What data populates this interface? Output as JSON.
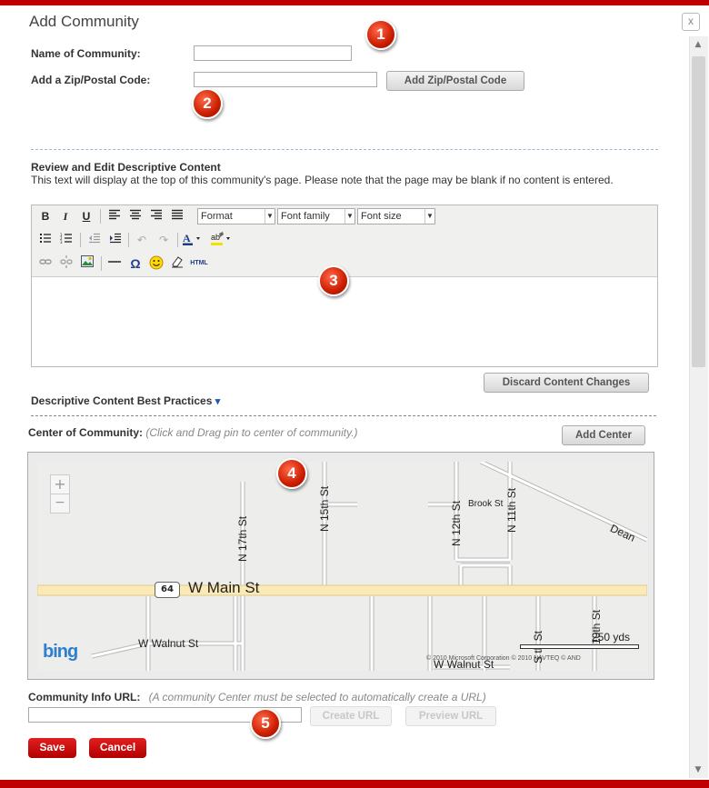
{
  "dialog": {
    "title": "Add Community",
    "close_glyph": "x"
  },
  "form": {
    "name_label": "Name of Community:",
    "name_value": "",
    "zip_label": "Add a Zip/Postal Code:",
    "zip_value": "",
    "add_zip_button": "Add Zip/Postal Code"
  },
  "content": {
    "heading": "Review and Edit Descriptive Content",
    "description": "This text will display at the top of this community's page. Please note that the page may be blank if no content is entered.",
    "editor": {
      "format_select": "Format",
      "font_family_select": "Font family",
      "font_size_select": "Font size",
      "bold": "B",
      "italic": "I",
      "underline": "U",
      "special_char": "Ω",
      "html_button": "HTML",
      "body_text": ""
    },
    "discard_button": "Discard Content Changes",
    "best_practices_link": "Descriptive Content Best Practices",
    "best_practices_arrow": "▾"
  },
  "center": {
    "label": "Center of Community:",
    "hint": "(Click and Drag pin to center of community.)",
    "add_center_button": "Add Center"
  },
  "map": {
    "zoom_in": "+",
    "zoom_out": "−",
    "streets": {
      "main": "W Main St",
      "walnut": "W Walnut St",
      "walnut_lower": "W Walnut St",
      "n17": "N 17th St",
      "n15": "N 15th St",
      "n12": "N 12th St",
      "n11": "N 11th St",
      "brook": "Brook St",
      "dean": "Dean",
      "s10": "10th St",
      "s_partial": "S   th St"
    },
    "route_shield": "64",
    "scale_label": "250 yds",
    "logo": "bing",
    "copyright": "© 2010 Microsoft Corporation  © 2010 NAVTEQ  © AND"
  },
  "url": {
    "label": "Community Info URL:",
    "hint": "(A community Center must be selected to automatically create a URL)",
    "value": "",
    "create_button": "Create URL",
    "preview_button": "Preview URL"
  },
  "actions": {
    "save": "Save",
    "cancel": "Cancel"
  },
  "callouts": [
    "1",
    "2",
    "3",
    "4",
    "5"
  ],
  "colors": {
    "accent_red": "#c00000",
    "button_red": "#cc0000",
    "dashed_divider": "#9ab7d3",
    "main_street": "#fbe9b6"
  }
}
